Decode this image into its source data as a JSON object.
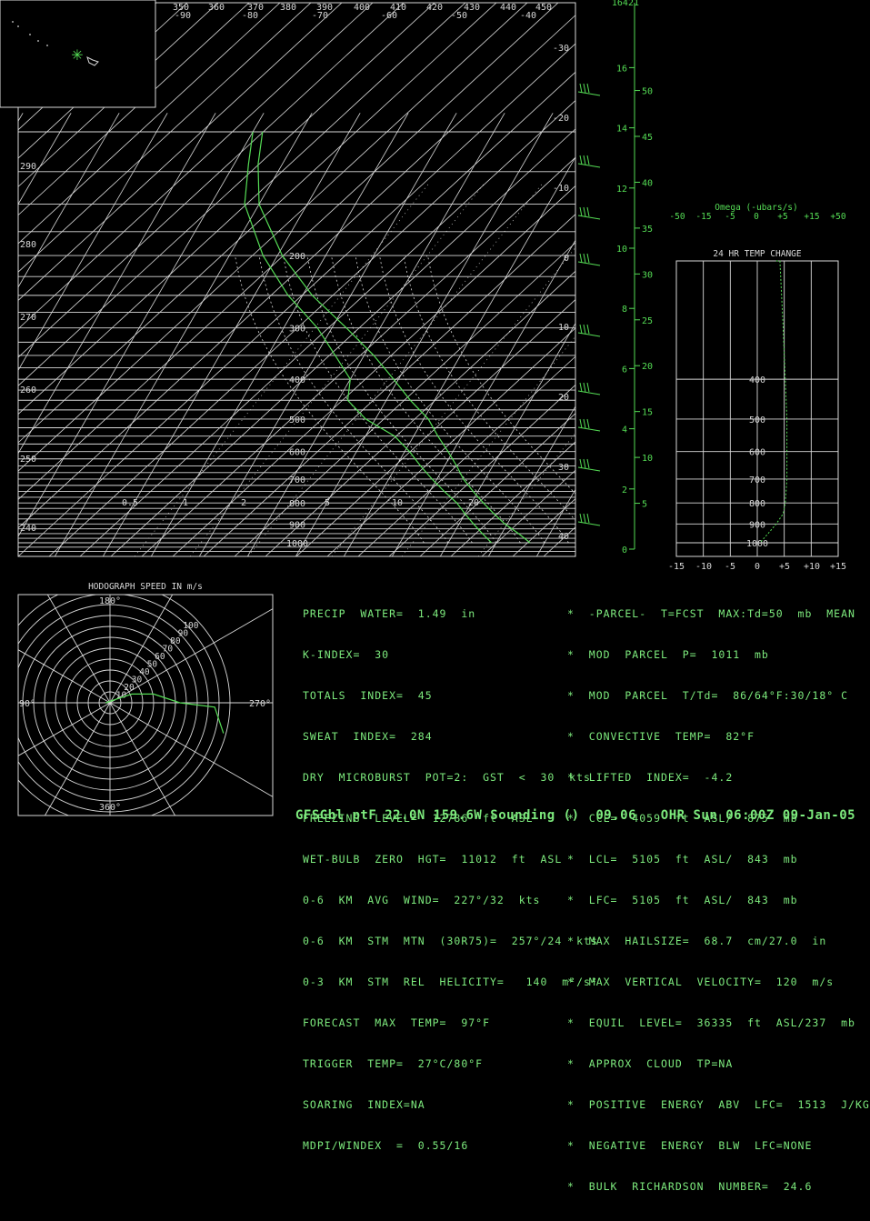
{
  "colors": {
    "background": "#000000",
    "grid": "#d8d8d8",
    "profile": "#55dd55",
    "text_green": "#7dea7d"
  },
  "chart_data": [
    {
      "type": "line",
      "name": "skew-t",
      "theta_labels": [
        "350",
        "360",
        "370",
        "380",
        "390",
        "400",
        "410",
        "420",
        "430",
        "440",
        "450"
      ],
      "top_temp_labels": [
        "-90",
        "-80",
        "-70",
        "-60",
        "-50",
        "-40"
      ],
      "right_temp_labels": [
        "-30",
        "-20",
        "-10",
        "0",
        "10",
        "20",
        "30",
        "40"
      ],
      "pressure_levels": [
        200,
        300,
        400,
        500,
        600,
        700,
        800,
        900,
        1000
      ],
      "left_theta_labels": [
        "290",
        "280",
        "270",
        "260",
        "250",
        "240"
      ],
      "mixing_ratio_labels": [
        "0.5",
        "1",
        "2",
        "5",
        "10",
        "20"
      ],
      "height_km_labels": [
        "16",
        "14",
        "12",
        "10",
        "8",
        "6",
        "4",
        "2",
        "0"
      ],
      "height_kft_labels": [
        "50",
        "45",
        "40",
        "35",
        "30",
        "25",
        "20",
        "15",
        "10",
        "5"
      ],
      "top_height_label": "16421",
      "temperature_profile": [
        {
          "p": 1000,
          "t": 27
        },
        {
          "p": 950,
          "t": 23.5
        },
        {
          "p": 900,
          "t": 19.5
        },
        {
          "p": 850,
          "t": 16
        },
        {
          "p": 800,
          "t": 12.5
        },
        {
          "p": 750,
          "t": 9
        },
        {
          "p": 700,
          "t": 5.5
        },
        {
          "p": 650,
          "t": 2.5
        },
        {
          "p": 600,
          "t": -1
        },
        {
          "p": 550,
          "t": -5
        },
        {
          "p": 500,
          "t": -9
        },
        {
          "p": 450,
          "t": -15
        },
        {
          "p": 400,
          "t": -21
        },
        {
          "p": 350,
          "t": -28
        },
        {
          "p": 300,
          "t": -37
        },
        {
          "p": 250,
          "t": -48
        },
        {
          "p": 200,
          "t": -59
        },
        {
          "p": 150,
          "t": -70
        },
        {
          "p": 120,
          "t": -75
        },
        {
          "p": 100,
          "t": -78
        }
      ],
      "dewpoint_profile": [
        {
          "p": 1000,
          "t": 19
        },
        {
          "p": 950,
          "t": 16
        },
        {
          "p": 900,
          "t": 13
        },
        {
          "p": 850,
          "t": 10
        },
        {
          "p": 800,
          "t": 7
        },
        {
          "p": 750,
          "t": 3
        },
        {
          "p": 700,
          "t": -1
        },
        {
          "p": 650,
          "t": -5
        },
        {
          "p": 600,
          "t": -9
        },
        {
          "p": 550,
          "t": -14
        },
        {
          "p": 500,
          "t": -22
        },
        {
          "p": 450,
          "t": -28
        },
        {
          "p": 400,
          "t": -30
        },
        {
          "p": 350,
          "t": -36
        },
        {
          "p": 300,
          "t": -43
        },
        {
          "p": 250,
          "t": -53
        },
        {
          "p": 200,
          "t": -63
        },
        {
          "p": 150,
          "t": -73
        },
        {
          "p": 120,
          "t": -77
        },
        {
          "p": 100,
          "t": -80
        }
      ]
    },
    {
      "type": "line",
      "name": "omega",
      "title": "Omega (-ubars/s)",
      "ticks": [
        "-50",
        "-15",
        "-5",
        "0",
        "+5",
        "+15",
        "+50"
      ]
    },
    {
      "type": "line",
      "name": "24 hr temp change",
      "title": "24 HR TEMP CHANGE",
      "x_ticks": [
        "-15",
        "-10",
        "-5",
        "0",
        "+5",
        "+10",
        "+15"
      ],
      "p_labels": [
        "400",
        "500",
        "600",
        "700",
        "800",
        "900",
        "1000"
      ],
      "profile": [
        {
          "p": 100,
          "dt": 3.5
        },
        {
          "p": 200,
          "dt": 4.2
        },
        {
          "p": 300,
          "dt": 4.8
        },
        {
          "p": 400,
          "dt": 5.2
        },
        {
          "p": 500,
          "dt": 5.5
        },
        {
          "p": 600,
          "dt": 5.5
        },
        {
          "p": 700,
          "dt": 5.5
        },
        {
          "p": 800,
          "dt": 5.2
        },
        {
          "p": 850,
          "dt": 4.8
        },
        {
          "p": 900,
          "dt": 3.5
        },
        {
          "p": 950,
          "dt": 2
        },
        {
          "p": 1000,
          "dt": 0.5
        }
      ]
    },
    {
      "type": "line",
      "name": "hodograph",
      "title": "HODOGRAPH SPEED IN m/s",
      "dir_labels": [
        "180°",
        "270°",
        "360°",
        "90°"
      ],
      "ring_labels": [
        "10",
        "20",
        "30",
        "40",
        "50",
        "60",
        "70",
        "80",
        "90",
        "100"
      ],
      "trace": [
        {
          "u": -1,
          "v": 0
        },
        {
          "u": 2,
          "v": 1
        },
        {
          "u": 5,
          "v": 2
        },
        {
          "u": 10,
          "v": 2
        },
        {
          "u": 16,
          "v": 0
        },
        {
          "u": 24,
          "v": -1
        },
        {
          "u": 25,
          "v": -4
        },
        {
          "u": 26,
          "v": -7
        }
      ]
    }
  ],
  "stats_left": [
    "PRECIP  WATER=  1.49  in",
    "K-INDEX=  30",
    "TOTALS  INDEX=  45",
    "SWEAT  INDEX=  284",
    "DRY  MICROBURST  POT=2:  GST  <  30  kts",
    "FREEZING  LEVEL=  12786  ft  ASL",
    "WET-BULB  ZERO  HGT=  11012  ft  ASL",
    "0-6  KM  AVG  WIND=  227°/32  kts",
    "0-6  KM  STM  MTN  (30R75)=  257°/24  kts",
    "0-3  KM  STM  REL  HELICITY=   140  m²/s²",
    "FORECAST  MAX  TEMP=  97°F",
    "TRIGGER  TEMP=  27°C/80°F",
    "SOARING  INDEX=NA",
    "MDPI/WINDEX  =  0.55/16"
  ],
  "stats_right": [
    "*  -PARCEL-  T=FCST  MAX:Td=50  mb  MEAN",
    "*  MOD  PARCEL  P=  1011  mb",
    "*  MOD  PARCEL  T/Td=  86/64°F:30/18° C",
    "*  CONVECTIVE  TEMP=  82°F",
    "*  LIFTED  INDEX=  -4.2",
    "*  CCL=  4059  ft  ASL/  875  mb",
    "*  LCL=  5105  ft  ASL/  843  mb",
    "*  LFC=  5105  ft  ASL/  843  mb",
    "*  MAX  HAILSIZE=  68.7  cm/27.0  in",
    "*  MAX  VERTICAL  VELOCITY=  120  m/s",
    "*  EQUIL  LEVEL=  36335  ft  ASL/237  mb",
    "*  APPROX  CLOUD  TP=NA",
    "*  POSITIVE  ENERGY  ABV  LFC=  1513  J/KG",
    "*  NEGATIVE  ENERGY  BLW  LFC=NONE",
    "*  BULK  RICHARDSON  NUMBER=  24.6"
  ],
  "footer": "GFSGbl ptF 22.0N 159.6W Sounding ()  09.06   OHR Sun 06:00Z 09-Jan-05"
}
